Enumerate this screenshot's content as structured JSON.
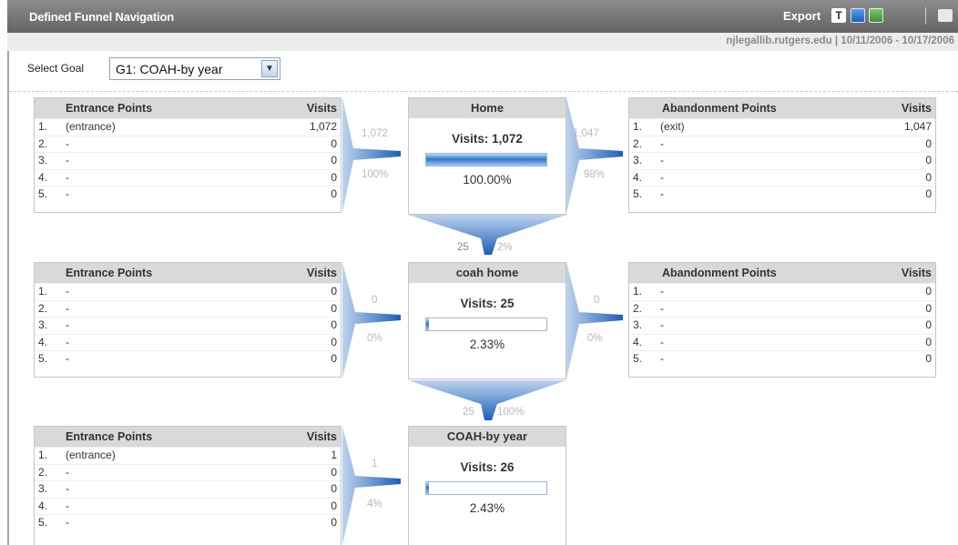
{
  "header": {
    "title": "Defined Funnel Navigation",
    "export_label": "Export",
    "export_icons": [
      "text-icon",
      "excel-icon",
      "csv-icon"
    ],
    "print_icon": "print-icon"
  },
  "subheader": {
    "site_and_range": "njlegallib.rutgers.edu  |  10/11/2006 - 10/17/2006"
  },
  "goal": {
    "label": "Select Goal",
    "selected": "G1: COAH-by year"
  },
  "table_headers": {
    "entrance": "Entrance Points",
    "abandonment": "Abandonment Points",
    "visits": "Visits"
  },
  "steps": [
    {
      "name": "Home",
      "visits_label": "Visits: 1,072",
      "percent": "100.00%",
      "fill_fraction": 1.0,
      "entrance": [
        {
          "num": "1.",
          "name": "(entrance)",
          "visits": "1,072"
        },
        {
          "num": "2.",
          "name": "-",
          "visits": "0"
        },
        {
          "num": "3.",
          "name": "-",
          "visits": "0"
        },
        {
          "num": "4.",
          "name": "-",
          "visits": "0"
        },
        {
          "num": "5.",
          "name": "-",
          "visits": "0"
        }
      ],
      "entrance_flow": {
        "count": "1,072",
        "pct": "100%"
      },
      "abandonment": [
        {
          "num": "1.",
          "name": "(exit)",
          "visits": "1,047"
        },
        {
          "num": "2.",
          "name": "-",
          "visits": "0"
        },
        {
          "num": "3.",
          "name": "-",
          "visits": "0"
        },
        {
          "num": "4.",
          "name": "-",
          "visits": "0"
        },
        {
          "num": "5.",
          "name": "-",
          "visits": "0"
        }
      ],
      "exit_flow": {
        "count": "1,047",
        "pct": "98%"
      },
      "next_flow": {
        "count": "25",
        "pct": "2%"
      }
    },
    {
      "name": "coah home",
      "visits_label": "Visits: 25",
      "percent": "2.33%",
      "fill_fraction": 0.0233,
      "entrance": [
        {
          "num": "1.",
          "name": "-",
          "visits": "0"
        },
        {
          "num": "2.",
          "name": "-",
          "visits": "0"
        },
        {
          "num": "3.",
          "name": "-",
          "visits": "0"
        },
        {
          "num": "4.",
          "name": "-",
          "visits": "0"
        },
        {
          "num": "5.",
          "name": "-",
          "visits": "0"
        }
      ],
      "entrance_flow": {
        "count": "0",
        "pct": "0%"
      },
      "abandonment": [
        {
          "num": "1.",
          "name": "-",
          "visits": "0"
        },
        {
          "num": "2.",
          "name": "-",
          "visits": "0"
        },
        {
          "num": "3.",
          "name": "-",
          "visits": "0"
        },
        {
          "num": "4.",
          "name": "-",
          "visits": "0"
        },
        {
          "num": "5.",
          "name": "-",
          "visits": "0"
        }
      ],
      "exit_flow": {
        "count": "0",
        "pct": "0%"
      },
      "next_flow": {
        "count": "25",
        "pct": "100%"
      }
    },
    {
      "name": "COAH-by year",
      "visits_label": "Visits: 26",
      "percent": "2.43%",
      "fill_fraction": 0.0243,
      "entrance": [
        {
          "num": "1.",
          "name": "(entrance)",
          "visits": "1"
        },
        {
          "num": "2.",
          "name": "-",
          "visits": "0"
        },
        {
          "num": "3.",
          "name": "-",
          "visits": "0"
        },
        {
          "num": "4.",
          "name": "-",
          "visits": "0"
        },
        {
          "num": "5.",
          "name": "-",
          "visits": "0"
        }
      ],
      "entrance_flow": {
        "count": "1",
        "pct": "4%"
      }
    }
  ],
  "colors": {
    "title_bar": "#777777",
    "funnel_blue": "#2a66b8",
    "bar_blue": "#2e74cc"
  }
}
